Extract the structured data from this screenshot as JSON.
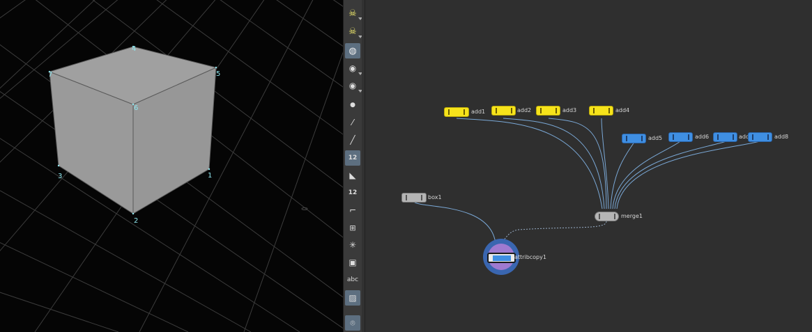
{
  "viewport": {
    "point_labels": [
      "4",
      "7",
      "5",
      "6",
      "3",
      "1",
      "2"
    ]
  },
  "toolbar": {
    "tools": [
      {
        "name": "select-tool",
        "icon": "skull-icon"
      },
      {
        "name": "view-tool",
        "icon": "skull-eye-icon"
      },
      {
        "name": "handle-tool",
        "icon": "globe-icon",
        "active": true
      },
      {
        "name": "camera-tool",
        "icon": "eye-brush-icon"
      },
      {
        "name": "render-tool",
        "icon": "eye-render-icon"
      },
      {
        "name": "point-tool",
        "icon": "dot-icon"
      },
      {
        "name": "brush-tool",
        "icon": "brush-icon"
      },
      {
        "name": "dropper-tool",
        "icon": "dropper-icon"
      },
      {
        "name": "display-numbers-tool",
        "icon": "point-number-icon",
        "label": "12",
        "active": true
      },
      {
        "name": "paint-tool",
        "icon": "bucket-icon"
      },
      {
        "name": "prim-numbers-tool",
        "icon": "prim-number-icon",
        "label": "12"
      },
      {
        "name": "curve-tool",
        "icon": "curve-icon"
      },
      {
        "name": "snap-tool",
        "icon": "snap-icon"
      },
      {
        "name": "vector-tool",
        "icon": "vector-icon"
      },
      {
        "name": "box-tool",
        "icon": "square-icon"
      },
      {
        "name": "text-tool",
        "icon": "text-icon",
        "label": "abc"
      },
      {
        "name": "background-tool",
        "icon": "image-icon",
        "active": true
      },
      {
        "name": "location-tool",
        "icon": "pin-icon",
        "active": true
      }
    ]
  },
  "network": {
    "nodes": [
      {
        "id": "add1",
        "label": "add1",
        "color": "yellow"
      },
      {
        "id": "add2",
        "label": "add2",
        "color": "yellow"
      },
      {
        "id": "add3",
        "label": "add3",
        "color": "yellow"
      },
      {
        "id": "add4",
        "label": "add4",
        "color": "yellow"
      },
      {
        "id": "add5",
        "label": "add5",
        "color": "blue"
      },
      {
        "id": "add6",
        "label": "add6",
        "color": "blue"
      },
      {
        "id": "add7",
        "label": "add7",
        "color": "blue"
      },
      {
        "id": "add8",
        "label": "add8",
        "color": "blue"
      },
      {
        "id": "box1",
        "label": "box1",
        "color": "gray"
      },
      {
        "id": "merge1",
        "label": "merge1",
        "color": "gray"
      },
      {
        "id": "attribcopy1",
        "label": "attribcopy1",
        "color": "blue"
      }
    ],
    "colors": {
      "yellow": "#f6e31b",
      "blue": "#3f8fe3",
      "gray": "#b5b5b5",
      "wire": "#7aa8d6",
      "selection": "#3a66b0"
    }
  }
}
